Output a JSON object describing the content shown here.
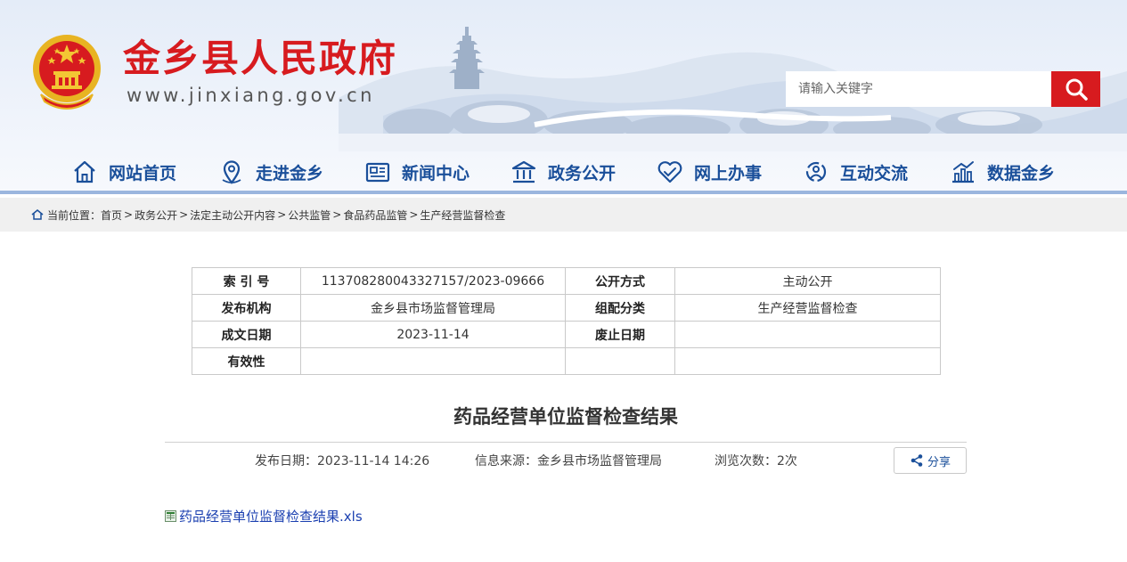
{
  "header": {
    "site_title": "金乡县人民政府",
    "site_url": "www.jinxiang.gov.cn",
    "search": {
      "placeholder": "请输入关键字"
    },
    "colors": {
      "brand_red": "#d71b1f",
      "nav_blue": "#1a4f9a"
    }
  },
  "nav": {
    "items": [
      {
        "label": "网站首页",
        "icon": "home-icon"
      },
      {
        "label": "走进金乡",
        "icon": "location-pin-icon"
      },
      {
        "label": "新闻中心",
        "icon": "news-icon"
      },
      {
        "label": "政务公开",
        "icon": "government-building-icon"
      },
      {
        "label": "网上办事",
        "icon": "handshake-icon"
      },
      {
        "label": "互动交流",
        "icon": "interaction-icon"
      },
      {
        "label": "数据金乡",
        "icon": "bar-chart-icon"
      }
    ]
  },
  "breadcrumb": {
    "prefix": "当前位置：",
    "items": [
      "首页",
      "政务公开",
      "法定主动公开内容",
      "公共监管",
      "食品药品监管",
      "生产经营监督检查"
    ],
    "separator": ">"
  },
  "info": {
    "rows": [
      [
        "索 引 号",
        "113708280043327157/2023-09666",
        "公开方式",
        "主动公开"
      ],
      [
        "发布机构",
        "金乡县市场监督管理局",
        "组配分类",
        "生产经营监督检查"
      ],
      [
        "成文日期",
        "2023-11-14",
        "废止日期",
        ""
      ],
      [
        "有效性",
        "",
        "",
        ""
      ]
    ]
  },
  "article": {
    "title": "药品经营单位监督检查结果",
    "publish_date": "发布日期：2023-11-14 14:26",
    "source": "信息来源：金乡县市场监督管理局",
    "views": "浏览次数：2次",
    "share_label": "分享",
    "attachment": "药品经营单位监督检查结果.xls"
  }
}
